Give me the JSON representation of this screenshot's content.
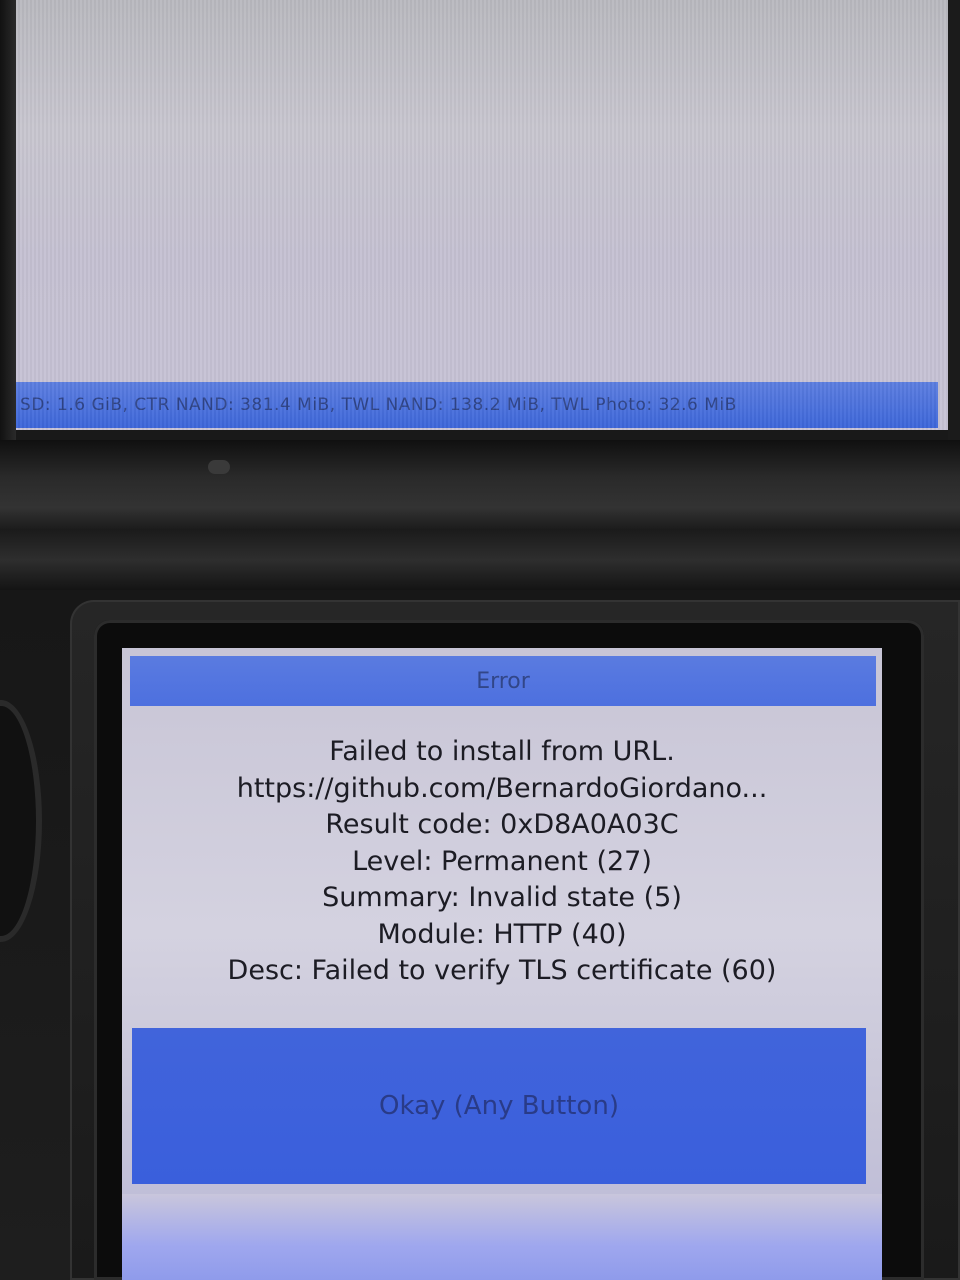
{
  "top_screen": {
    "status_bar": {
      "text": "SD: 1.6 GiB, CTR NAND: 381.4 MiB, TWL NAND: 138.2 MiB, TWL Photo: 32.6 MiB"
    }
  },
  "dialog": {
    "title": "Error",
    "lines": [
      "Failed to install from URL.",
      "https://github.com/BernardoGiordano...",
      "Result code: 0xD8A0A03C",
      "Level: Permanent (27)",
      "Summary: Invalid state (5)",
      "Module: HTTP (40)",
      "Desc: Failed to verify TLS certificate (60)"
    ],
    "button_label": "Okay (Any Button)"
  },
  "colors": {
    "accent_blue": "#3d66da",
    "button_blue": "#3a5fdc",
    "screen_background": "#cfcddd"
  }
}
